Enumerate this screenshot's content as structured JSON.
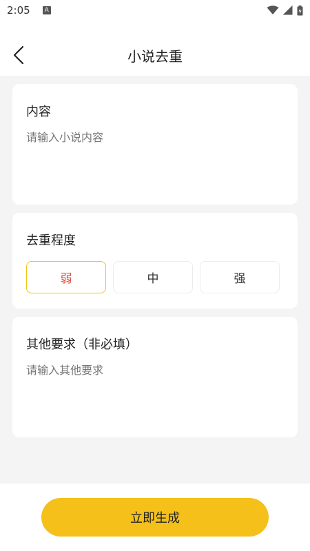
{
  "status_bar": {
    "time": "2:05",
    "notification_letter": "A"
  },
  "header": {
    "title": "小说去重"
  },
  "content_card": {
    "title": "内容",
    "placeholder": "请输入小说内容"
  },
  "level_card": {
    "title": "去重程度",
    "options": [
      "弱",
      "中",
      "强"
    ],
    "selected": "弱"
  },
  "other_card": {
    "title": "其他要求（非必填）",
    "placeholder": "请输入其他要求"
  },
  "footer": {
    "submit_label": "立即生成"
  },
  "colors": {
    "accent": "#f5c01a",
    "selected_text": "#d9473a",
    "background": "#f4f4f4"
  }
}
